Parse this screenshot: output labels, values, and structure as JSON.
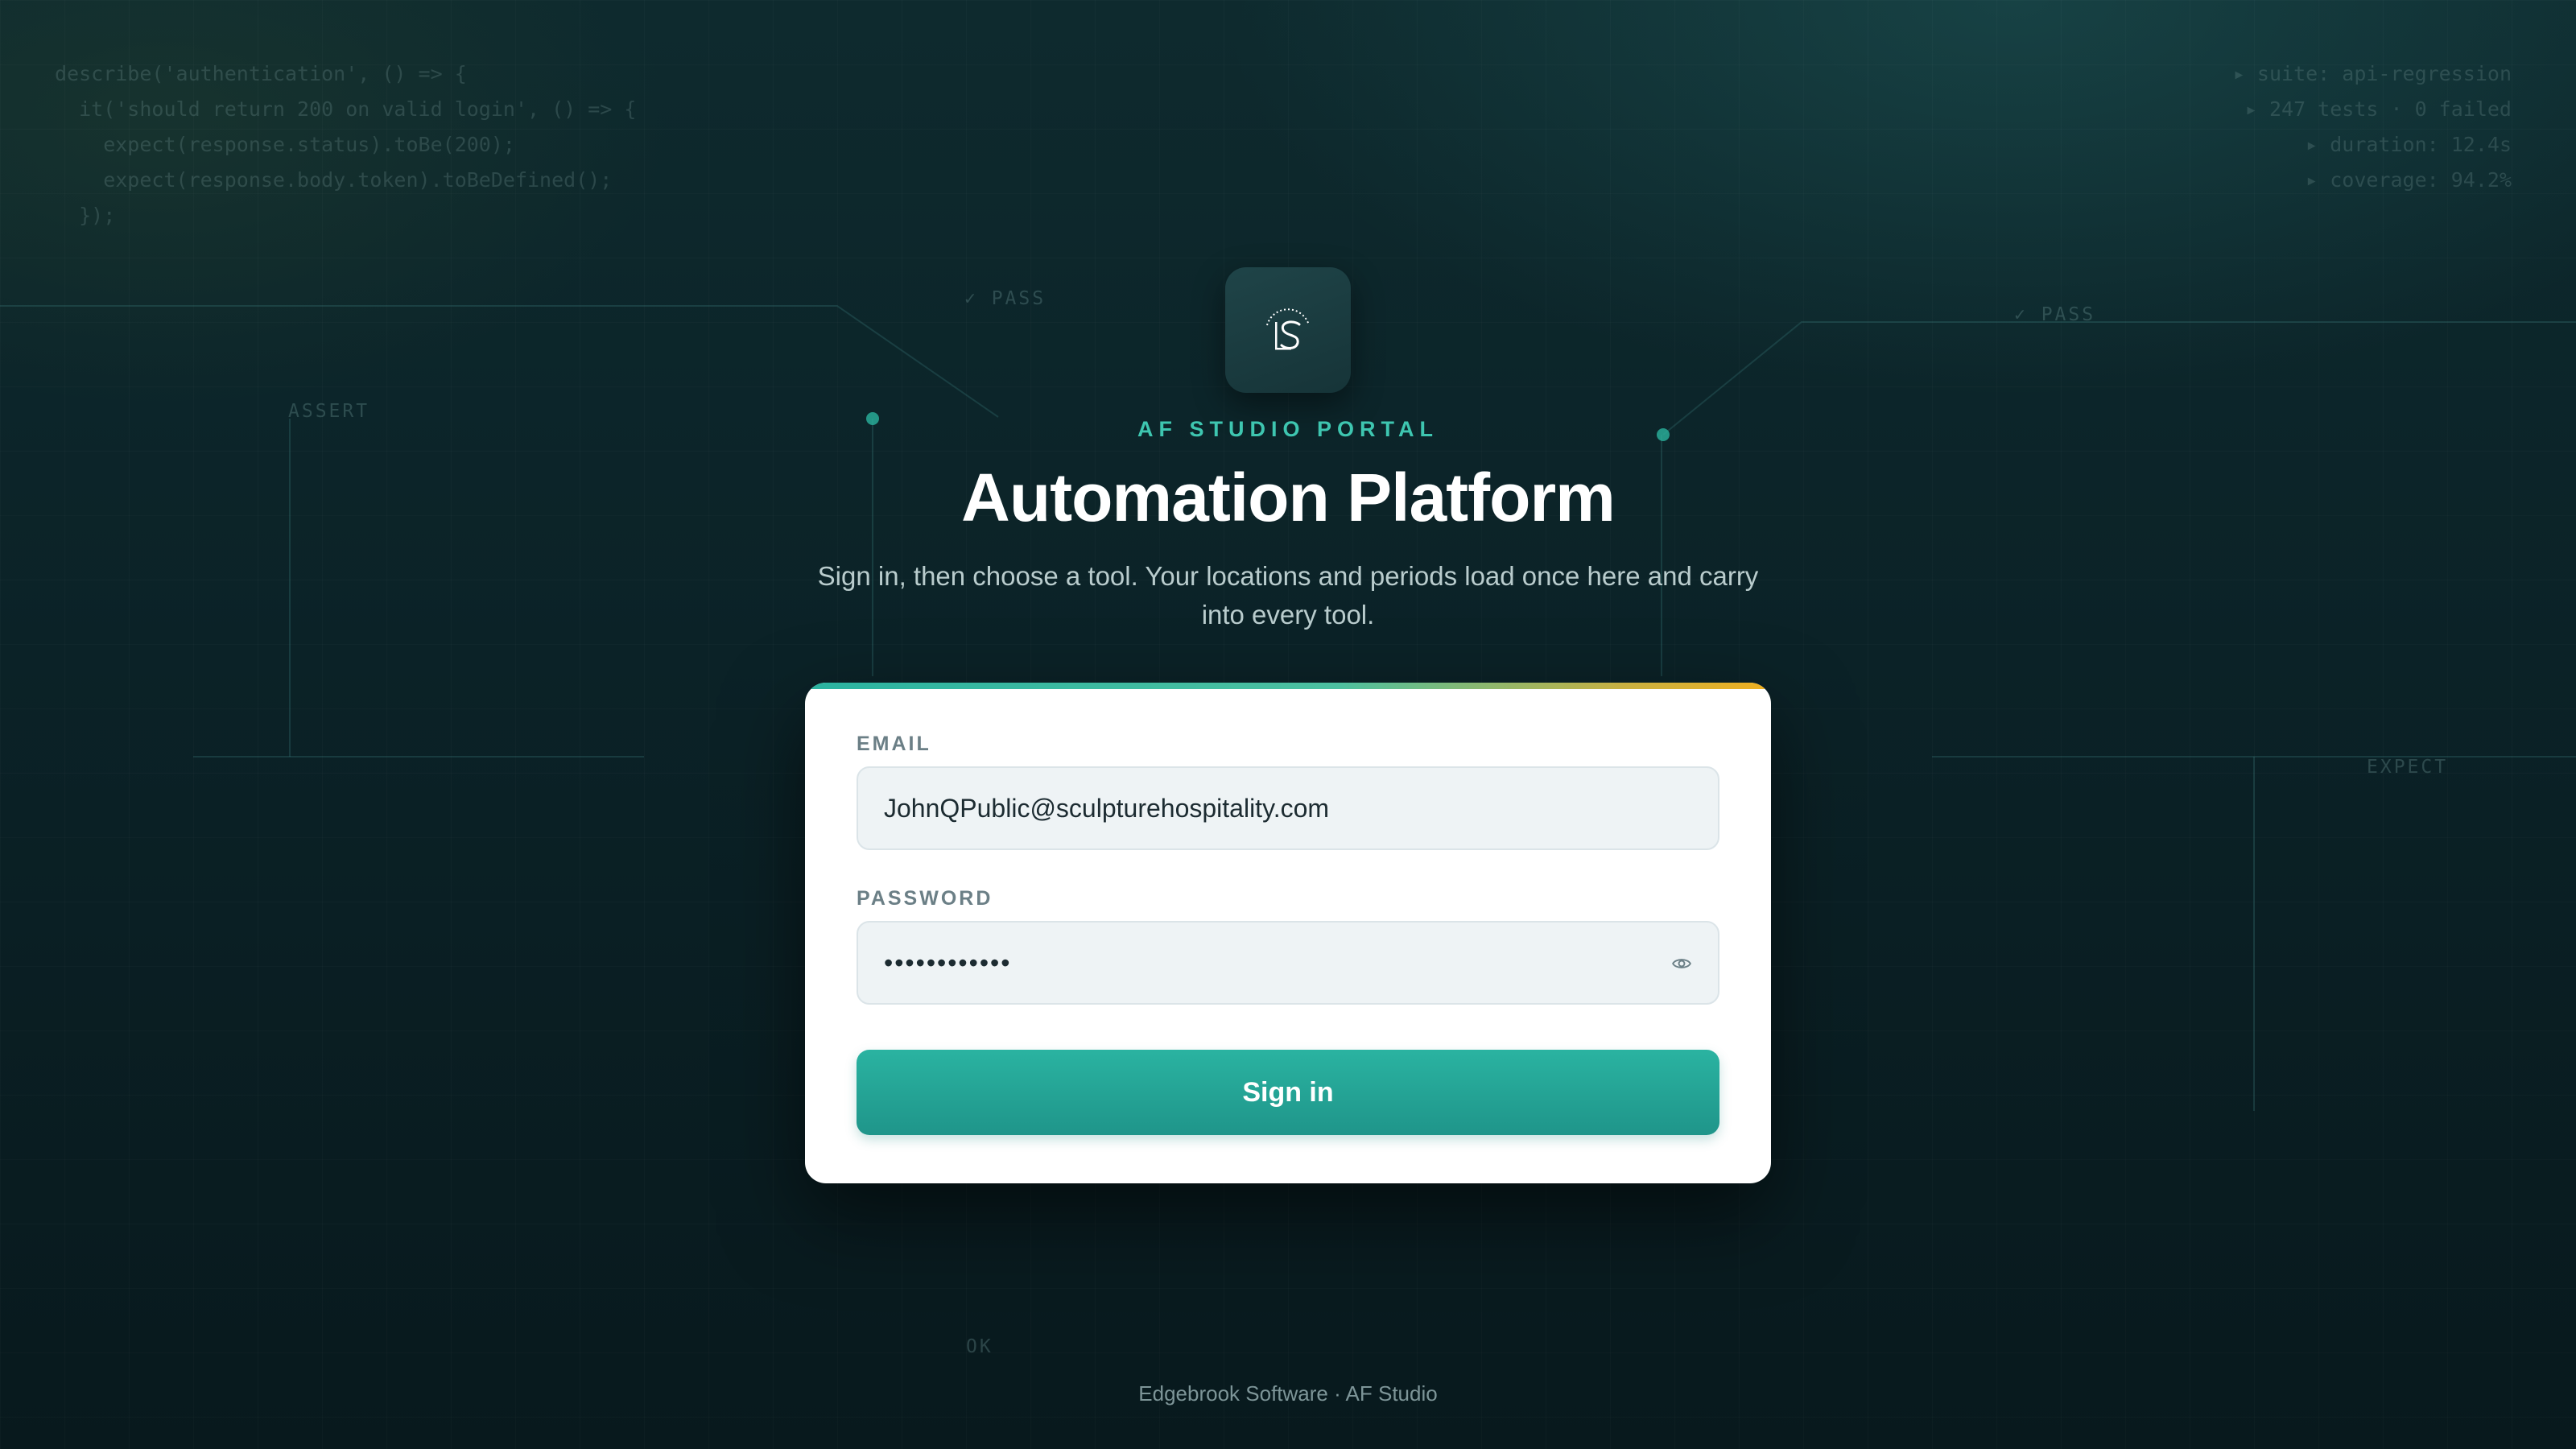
{
  "background": {
    "code_left": [
      "describe('authentication', () => {",
      "  it('should return 200 on valid login', () => {",
      "    expect(response.status).toBe(200);",
      "    expect(response.body.token).toBeDefined();",
      "  });"
    ],
    "code_right": [
      "▸ suite: api-regression",
      "▸ 247 tests · 0 failed",
      "▸ duration: 12.4s",
      "▸ coverage: 94.2%"
    ],
    "labels": {
      "pass_left": "✓ PASS",
      "pass_right": "✓ PASS",
      "assert": "ASSERT",
      "expect": "EXPECT",
      "ok": "OK"
    }
  },
  "brand": {
    "eyebrow": "AF STUDIO PORTAL",
    "title": "Automation Platform",
    "subtitle": "Sign in, then choose a tool. Your locations and periods load once here and carry into every tool."
  },
  "form": {
    "email_label": "EMAIL",
    "email_value": "JohnQPublic@sculpturehospitality.com",
    "password_label": "PASSWORD",
    "password_value": "••••••••••••",
    "submit_label": "Sign in"
  },
  "footer": {
    "text": "Edgebrook Software · AF Studio"
  },
  "colors": {
    "accent": "#2ab3a1",
    "eyebrow": "#3ec6b0",
    "card": "#ffffff",
    "background": "#0b2227"
  },
  "icons": {
    "logo": "sculpture-s-logo-icon",
    "password_toggle": "eye-icon"
  }
}
